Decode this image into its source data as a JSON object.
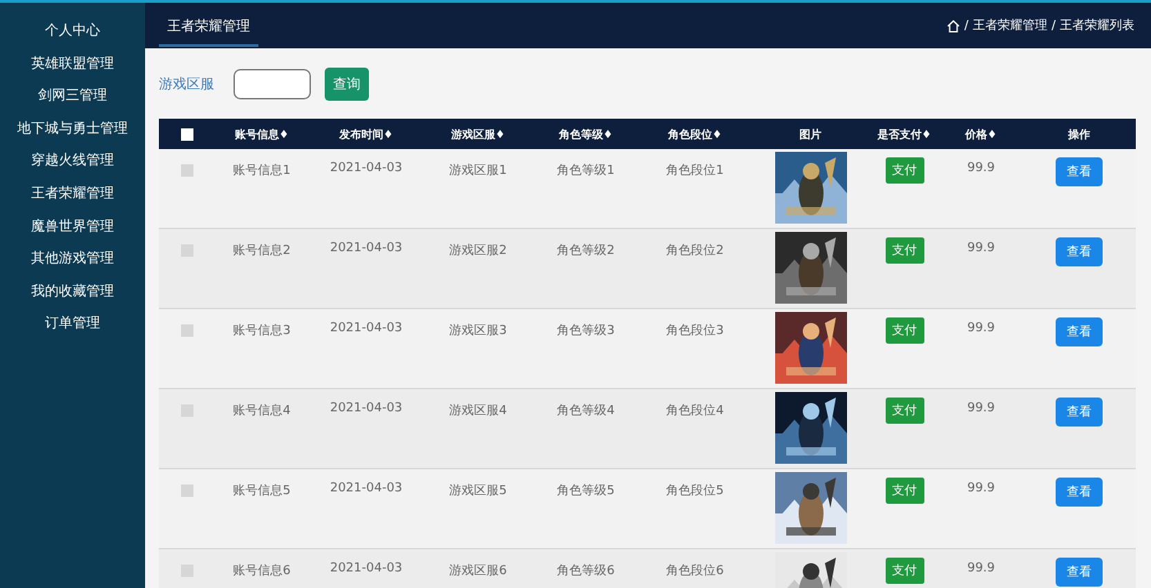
{
  "sidebar": {
    "items": [
      {
        "label": "个人中心"
      },
      {
        "label": "英雄联盟管理"
      },
      {
        "label": "剑网三管理"
      },
      {
        "label": "地下城与勇士管理"
      },
      {
        "label": "穿越火线管理"
      },
      {
        "label": "王者荣耀管理"
      },
      {
        "label": "魔兽世界管理"
      },
      {
        "label": "其他游戏管理"
      },
      {
        "label": "我的收藏管理"
      },
      {
        "label": "订单管理"
      }
    ]
  },
  "topbar": {
    "tab": "王者荣耀管理",
    "breadcrumb": [
      {
        "separator": "/",
        "label": "王者荣耀管理"
      },
      {
        "separator": "/",
        "label": "王者荣耀列表"
      }
    ]
  },
  "search": {
    "label": "游戏区服",
    "button": "查询"
  },
  "table": {
    "all_checked": false,
    "columns": [
      "账号信息♦",
      "发布时间♦",
      "游戏区服♦",
      "角色等级♦",
      "角色段位♦",
      "图片",
      "是否支付♦",
      "价格♦",
      "操作"
    ],
    "rows": [
      {
        "checked": false,
        "account": "账号信息1",
        "date": "2021-04-03",
        "server": "游戏区服1",
        "level": "角色等级1",
        "rank": "角色段位1",
        "pay": "支付",
        "price": "99.9",
        "action": "查看"
      },
      {
        "checked": false,
        "account": "账号信息2",
        "date": "2021-04-03",
        "server": "游戏区服2",
        "level": "角色等级2",
        "rank": "角色段位2",
        "pay": "支付",
        "price": "99.9",
        "action": "查看"
      },
      {
        "checked": false,
        "account": "账号信息3",
        "date": "2021-04-03",
        "server": "游戏区服3",
        "level": "角色等级3",
        "rank": "角色段位3",
        "pay": "支付",
        "price": "99.9",
        "action": "查看"
      },
      {
        "checked": false,
        "account": "账号信息4",
        "date": "2021-04-03",
        "server": "游戏区服4",
        "level": "角色等级4",
        "rank": "角色段位4",
        "pay": "支付",
        "price": "99.9",
        "action": "查看"
      },
      {
        "checked": false,
        "account": "账号信息5",
        "date": "2021-04-03",
        "server": "游戏区服5",
        "level": "角色等级5",
        "rank": "角色段位5",
        "pay": "支付",
        "price": "99.9",
        "action": "查看"
      },
      {
        "checked": false,
        "account": "账号信息6",
        "date": "2021-04-03",
        "server": "游戏区服6",
        "level": "角色等级6",
        "rank": "角色段位6",
        "pay": "支付",
        "price": "99.9",
        "action": "查看"
      }
    ]
  }
}
